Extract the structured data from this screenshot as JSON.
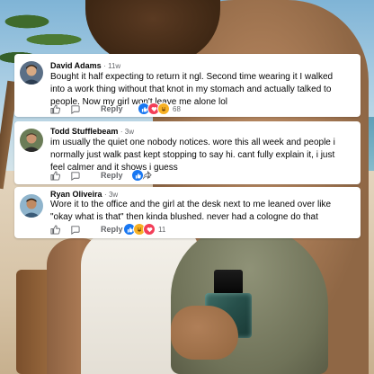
{
  "comments": [
    {
      "name": "David Adams",
      "time": "11w",
      "text": "Bought it half expecting to return it ngl. Second time wearing it I walked into a work thing without that knot in my stomach and actually talked to people. Now my girl won't leave me alone lol",
      "reply_label": "Reply",
      "reactions": [
        "like",
        "love",
        "haha"
      ],
      "reaction_count": "68"
    },
    {
      "name": "Todd Stufflebeam",
      "time": "3w",
      "text": "im usually the quiet one nobody notices. wore this all week and people i normally just walk past kept stopping to say hi. cant fully explain it, i just feel calmer and it shows i guess",
      "reply_label": "Reply",
      "reactions": [
        "like"
      ],
      "reaction_count": "1"
    },
    {
      "name": "Ryan Oliveira",
      "time": "3w",
      "text": "Wore it to the office and the girl at the desk next to me leaned over like \"okay what is that\" then kinda blushed. never had a cologne do that",
      "reply_label": "Reply",
      "reactions": [
        "like",
        "haha",
        "love"
      ],
      "reaction_count": "11"
    }
  ],
  "colors": {
    "like": "#1877f2",
    "love": "#f33e58",
    "haha": "#f7b125",
    "meta_text": "#65676b",
    "card_bg": "#ffffff"
  },
  "icons": {
    "like_action": "thumbs-up-outline-icon",
    "reply_action": "reply-bubble-icon",
    "share_action": "share-icon"
  }
}
